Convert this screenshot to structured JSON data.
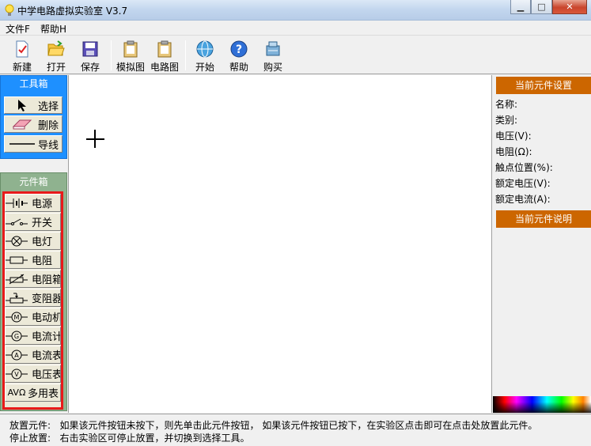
{
  "window": {
    "title": "中学电路虚拟实验室 V3.7",
    "minimize_glyph": "▁",
    "maximize_glyph": "□",
    "close_glyph": "✕"
  },
  "menu": [
    "文件F",
    "帮助H"
  ],
  "toolbar": {
    "new": "新建",
    "open": "打开",
    "save": "保存",
    "simulation_view": "模拟图",
    "circuit_view": "电路图",
    "start": "开始",
    "help": "帮助",
    "buy": "购买"
  },
  "toolbox": {
    "title": "工具箱",
    "items": [
      "选择",
      "删除",
      "导线"
    ]
  },
  "component_box": {
    "title": "元件箱",
    "items": [
      {
        "label": "电源",
        "icon": "battery-icon"
      },
      {
        "label": "开关",
        "icon": "switch-icon"
      },
      {
        "label": "电灯",
        "icon": "lamp-icon"
      },
      {
        "label": "电阻",
        "icon": "resistor-icon"
      },
      {
        "label": "电阻箱",
        "icon": "resistance-box-icon"
      },
      {
        "label": "变阻器",
        "icon": "rheostat-icon"
      },
      {
        "label": "电动机",
        "icon": "motor-icon"
      },
      {
        "label": "电流计",
        "icon": "galvanometer-icon"
      },
      {
        "label": "电流表",
        "icon": "ammeter-icon"
      },
      {
        "label": "电压表",
        "icon": "voltmeter-icon"
      },
      {
        "label": "多用表",
        "icon": "multimeter-icon"
      }
    ],
    "icon_letters": {
      "motor": "M",
      "galvanometer": "G",
      "ammeter": "A",
      "voltmeter": "V",
      "multimeter": "AVΩ"
    }
  },
  "properties": {
    "title": "当前元件设置",
    "fields": [
      "名称:",
      "类别:",
      "电压(V):",
      "电阻(Ω):",
      "触点位置(%):",
      "额定电压(V):",
      "额定电流(A):"
    ],
    "description_title": "当前元件说明"
  },
  "status": {
    "line1_label": "放置元件:",
    "line1_text": "如果该元件按钮未按下，则先单击此元件按钮， 如果该元件按钮已按下，在实验区点击即可在点击处放置此元件。",
    "line2_label": "停止放置:",
    "line2_text": "右击实验区可停止放置，并切换到选择工具。"
  }
}
